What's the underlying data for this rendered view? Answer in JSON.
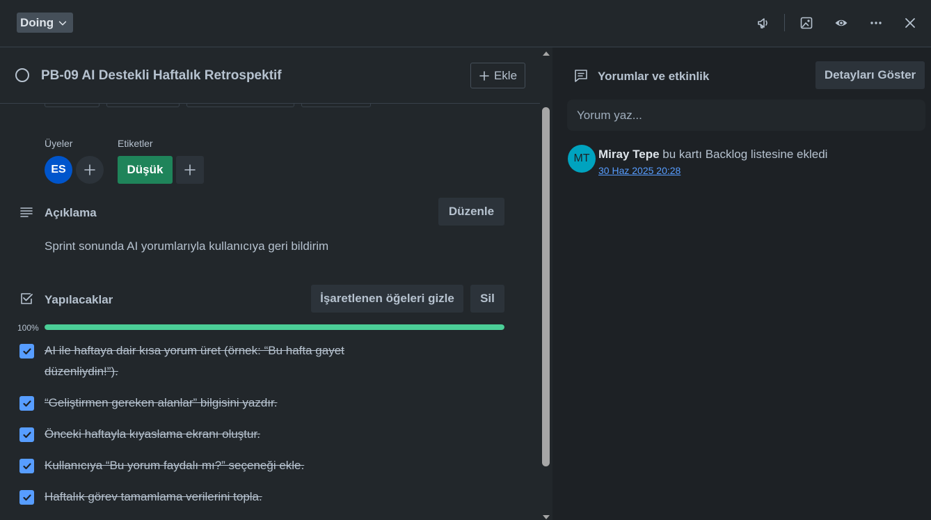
{
  "header": {
    "list_name": "Doing",
    "icons": [
      "megaphone-icon",
      "image-icon",
      "eye-icon",
      "more-icon",
      "close-icon"
    ]
  },
  "card": {
    "title": "PB-09 AI Destekli Haftalık Retrospektif",
    "add_label": "Ekle"
  },
  "members": {
    "label": "Üyeler",
    "avatar_initials": "ES",
    "avatar_color": "#0055cc"
  },
  "labels": {
    "label": "Etiketler",
    "chip_text": "Düşük",
    "chip_color": "#1f845a"
  },
  "description": {
    "title": "Açıklama",
    "edit_label": "Düzenle",
    "text": "Sprint sonunda AI yorumlarıyla kullanıcıya geri bildirim"
  },
  "checklist": {
    "title": "Yapılacaklar",
    "hide_checked_label": "İşaretlenen öğeleri gizle",
    "delete_label": "Sil",
    "progress_text": "100%",
    "progress_value": 100,
    "items": [
      {
        "line1": "AI ile haftaya dair kısa yorum üret (örnek: “Bu hafta gayet",
        "line2": "düzenliydin!”).",
        "checked": true
      },
      {
        "line1": "“Geliştirmen gereken alanlar” bilgisini yazdır.",
        "checked": true
      },
      {
        "line1": "Önceki haftayla kıyaslama ekranı oluştur.",
        "checked": true
      },
      {
        "line1": "Kullanıcıya “Bu yorum faydalı mı?” seçeneği ekle.",
        "checked": true
      },
      {
        "line1": "Haftalık görev tamamlama verilerini topla.",
        "checked": true
      }
    ]
  },
  "activity": {
    "title": "Yorumlar ve etkinlik",
    "details_label": "Detayları Göster",
    "comment_placeholder": "Yorum yaz...",
    "entry": {
      "avatar_initials": "MT",
      "avatar_color": "#00a3bf",
      "user": "Miray Tepe",
      "action": " bu kartı Backlog listesine ekledi",
      "timestamp": "30 Haz 2025 20:28"
    }
  },
  "colors": {
    "background": "#1d2125",
    "panel": "#22272b",
    "accent": "#579dff",
    "progress": "#4bce97"
  }
}
